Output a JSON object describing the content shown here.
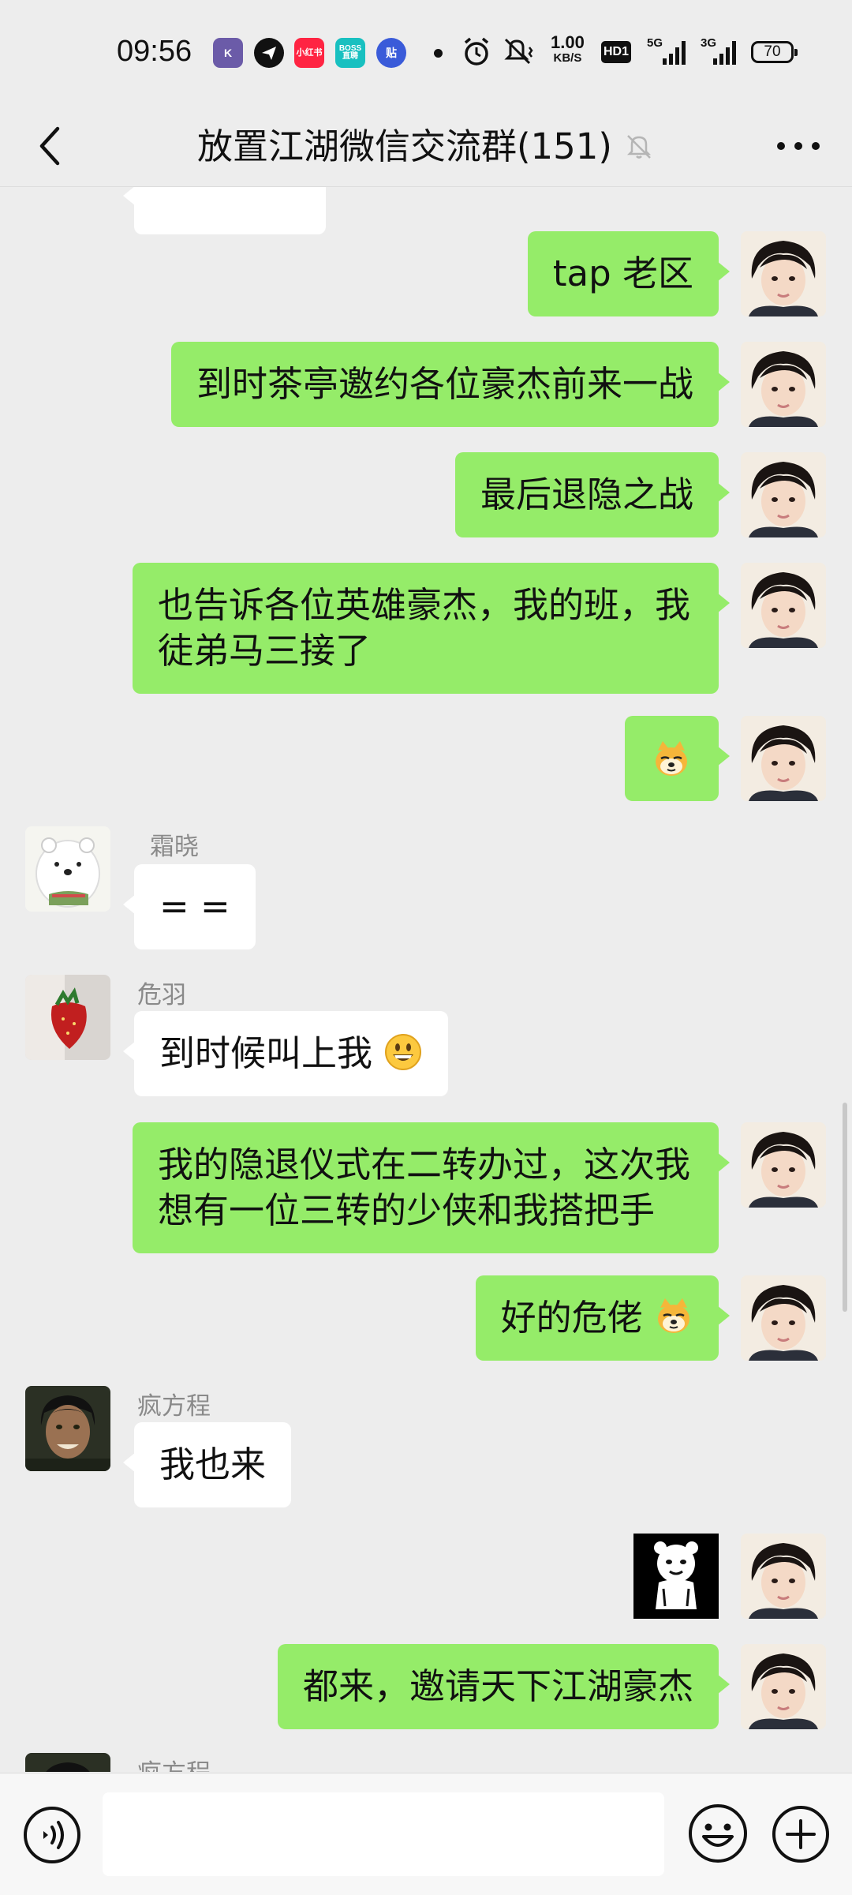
{
  "status_bar": {
    "time": "09:56",
    "apps": [
      {
        "label": "K",
        "color": "#6b5ba8"
      },
      {
        "label": "",
        "color": "#111111"
      },
      {
        "label": "小红书",
        "color": "#ff2442"
      },
      {
        "label": "BOSS直聘",
        "color": "#18c0c0"
      },
      {
        "label": "贴",
        "color": "#3a5bd9"
      }
    ],
    "net_speed_value": "1.00",
    "net_speed_unit": "KB/S",
    "hd_label": "HD1",
    "net1_label": "5G",
    "net2_label": "3G",
    "battery": "70"
  },
  "header": {
    "title": "放置江湖微信交流群(151)"
  },
  "messages": [
    {
      "side": "out",
      "text": "tap 老区"
    },
    {
      "side": "out",
      "text": "到时茶亭邀约各位豪杰前来一战"
    },
    {
      "side": "out",
      "text": "最后退隐之战"
    },
    {
      "side": "out",
      "text_line1": "也告诉各位英雄豪杰，我的班，我",
      "text_line2": "徒弟马三接了"
    },
    {
      "side": "out",
      "type": "emoji"
    },
    {
      "side": "in",
      "sender": "霜晓",
      "text": "= ="
    },
    {
      "side": "in",
      "sender": "危羽",
      "text": "到时候叫上我"
    },
    {
      "side": "out",
      "text_line1": "我的隐退仪式在二转办过，这次我",
      "text_line2": "想有一位三转的少侠和我搭把手"
    },
    {
      "side": "out",
      "text": "好的危佬"
    },
    {
      "side": "in",
      "sender": "疯方程",
      "text": "我也来"
    },
    {
      "side": "out",
      "type": "sticker"
    },
    {
      "side": "out",
      "text": "都来，邀请天下江湖豪杰"
    },
    {
      "side": "in",
      "sender": "疯方程",
      "text": ""
    }
  ],
  "input": {
    "value": "",
    "placeholder": ""
  },
  "colors": {
    "background": "#ededed",
    "outgoing_bubble": "#95ec69",
    "incoming_bubble": "#ffffff"
  },
  "icons": [
    "back-arrow-icon",
    "mute-bell-icon",
    "more-dots-icon",
    "voice-icon",
    "emoji-icon",
    "plus-icon"
  ]
}
